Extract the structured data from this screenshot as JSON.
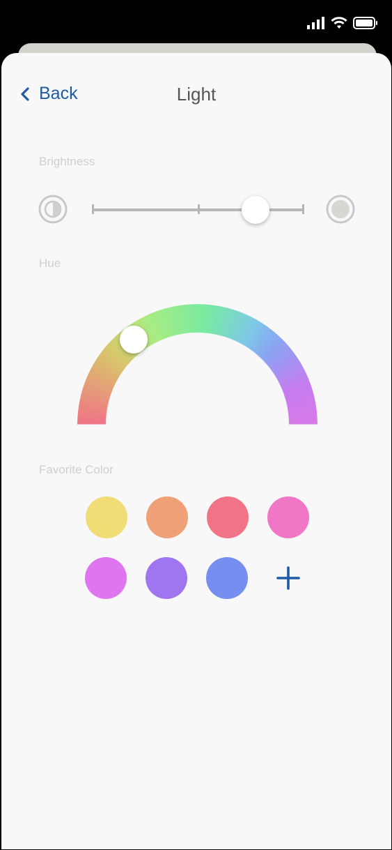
{
  "nav": {
    "back_label": "Back",
    "title": "Light"
  },
  "brightness": {
    "label": "Brightness",
    "value_fraction": 0.77
  },
  "hue": {
    "label": "Hue",
    "value_fraction": 0.29
  },
  "favorites": {
    "label": "Favorite Color",
    "colors": [
      "#f0dd76",
      "#f0a076",
      "#f07486",
      "#f076c6",
      "#de76f0",
      "#a076f0",
      "#768ef0"
    ],
    "add_icon": "plus-icon"
  },
  "colors": {
    "accent": "#1f5aa6",
    "sheet_bg": "#f8f8f8"
  }
}
